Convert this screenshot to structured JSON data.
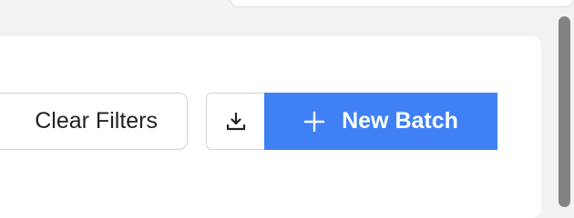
{
  "toolbar": {
    "clear_filters_label": "Clear Filters",
    "download_icon": "download-icon",
    "new_batch_label": "New Batch",
    "new_batch_icon": "plus-icon"
  },
  "colors": {
    "primary": "#3f80f5",
    "background": "#f2f2f2",
    "panel": "#ffffff",
    "border": "#d2d2d2",
    "scrollbar_thumb": "#838383"
  }
}
